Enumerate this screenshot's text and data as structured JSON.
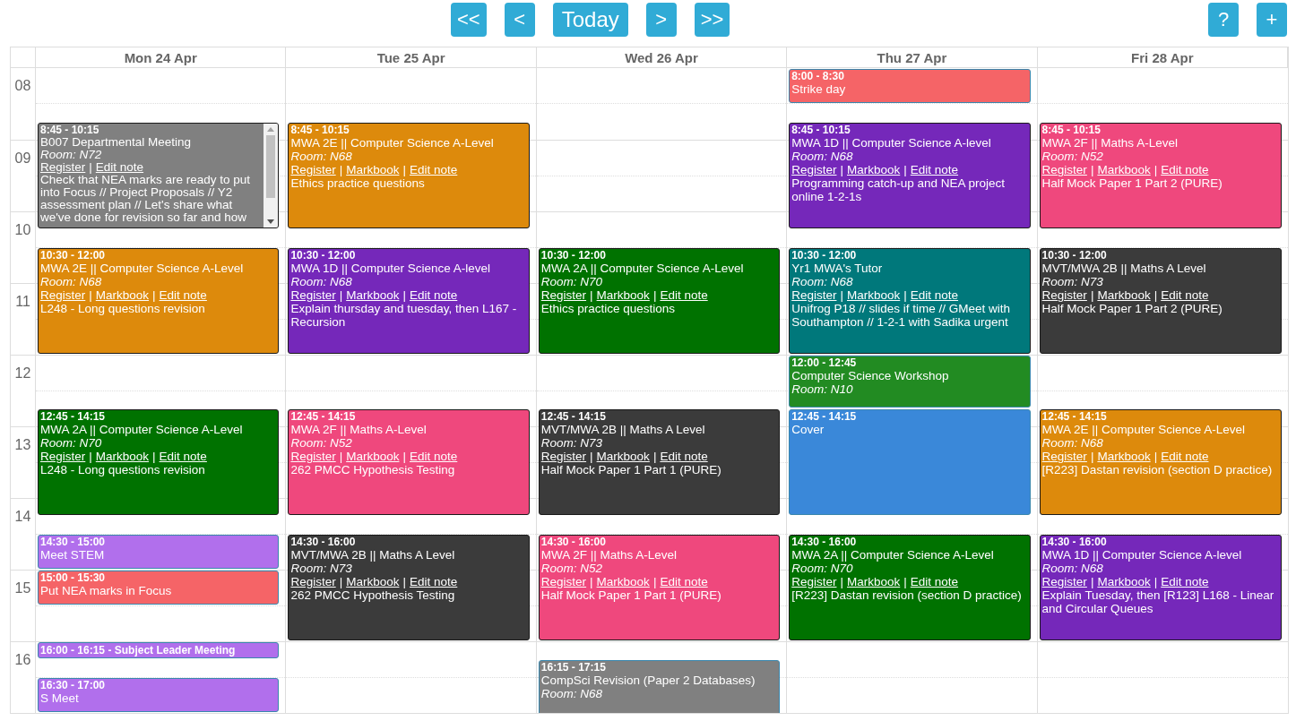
{
  "toolbar": {
    "nav_buttons": [
      "<<",
      "<",
      "Today",
      ">",
      ">>"
    ],
    "action_buttons": [
      "?",
      "+"
    ]
  },
  "link_separator": "|",
  "hours": [
    "08",
    "09",
    "10",
    "11",
    "12",
    "13",
    "14",
    "15",
    "16"
  ],
  "days": [
    {
      "header": "Mon 24 Apr",
      "events": [
        {
          "kind": "lesson",
          "color": "#808080",
          "time": "8:45 - 10:15",
          "title": "B007 Departmental Meeting",
          "room": "Room: N72",
          "links": [
            "Register",
            "Edit note"
          ],
          "note": "Check that NEA marks are ready to put into Focus // Project Proposals // Y2 assessment plan // Let's share what we've done for revision so far and how",
          "scrollable": true
        },
        {
          "kind": "lesson",
          "color": "#dd8a0c",
          "time": "10:30 - 12:00",
          "title": "MWA 2E || Computer Science A-Level",
          "room": "Room: N68",
          "links": [
            "Register",
            "Markbook",
            "Edit note"
          ],
          "note": "L248 - Long questions revision"
        },
        {
          "kind": "lesson",
          "color": "#007200",
          "time": "12:45 - 14:15",
          "title": "MWA 2A || Computer Science A-Level",
          "room": "Room: N70",
          "links": [
            "Register",
            "Markbook",
            "Edit note"
          ],
          "note": "L248 - Long questions revision"
        },
        {
          "kind": "meeting",
          "color": "#b16fec",
          "time": "14:30 - 15:00",
          "title": "Meet STEM"
        },
        {
          "kind": "meeting",
          "color": "#f56467",
          "time": "15:00 - 15:30",
          "title": "Put NEA marks in Focus"
        },
        {
          "kind": "compact",
          "color": "#b16fec",
          "label": "16:00 - 16:15 - Subject Leader Meeting"
        },
        {
          "kind": "meeting",
          "color": "#b16fec",
          "time": "16:30 - 17:00",
          "title": "S Meet"
        }
      ]
    },
    {
      "header": "Tue 25 Apr",
      "events": [
        {
          "kind": "lesson",
          "color": "#dd8a0c",
          "time": "8:45 - 10:15",
          "title": "MWA 2E || Computer Science A-Level",
          "room": "Room: N68",
          "links": [
            "Register",
            "Markbook",
            "Edit note"
          ],
          "note": "Ethics practice questions"
        },
        {
          "kind": "lesson",
          "color": "#7528ba",
          "time": "10:30 - 12:00",
          "title": "MWA 1D || Computer Science A-level",
          "room": "Room: N68",
          "links": [
            "Register",
            "Markbook",
            "Edit note"
          ],
          "note": "Explain thursday and tuesday, then L167 - Recursion"
        },
        {
          "kind": "lesson",
          "color": "#ef487d",
          "time": "12:45 - 14:15",
          "title": "MWA 2F || Maths A-Level",
          "room": "Room: N52",
          "links": [
            "Register",
            "Markbook",
            "Edit note"
          ],
          "note": "262 PMCC Hypothesis Testing"
        },
        {
          "kind": "lesson",
          "color": "#3b3b3b",
          "time": "14:30 - 16:00",
          "title": "MVT/MWA 2B || Maths A Level",
          "room": "Room: N73",
          "links": [
            "Register",
            "Markbook",
            "Edit note"
          ],
          "note": "262 PMCC Hypothesis Testing"
        }
      ]
    },
    {
      "header": "Wed 26 Apr",
      "events": [
        {
          "kind": "lesson",
          "color": "#007200",
          "time": "10:30 - 12:00",
          "title": "MWA 2A || Computer Science A-Level",
          "room": "Room: N70",
          "links": [
            "Register",
            "Markbook",
            "Edit note"
          ],
          "note": "Ethics practice questions"
        },
        {
          "kind": "lesson",
          "color": "#3b3b3b",
          "time": "12:45 - 14:15",
          "title": "MVT/MWA 2B || Maths A Level",
          "room": "Room: N73",
          "links": [
            "Register",
            "Markbook",
            "Edit note"
          ],
          "note": "Half Mock Paper 1 Part 1 (PURE)"
        },
        {
          "kind": "lesson",
          "color": "#ef487d",
          "time": "14:30 - 16:00",
          "title": "MWA 2F || Maths A-Level",
          "room": "Room: N52",
          "links": [
            "Register",
            "Markbook",
            "Edit note"
          ],
          "note": "Half Mock Paper 1 Part 1 (PURE)"
        },
        {
          "kind": "meeting",
          "color": "#808080",
          "time": "16:15 - 17:15",
          "title": "CompSci Revision (Paper 2 Databases)",
          "room": "Room: N68"
        }
      ]
    },
    {
      "header": "Thu 27 Apr",
      "events": [
        {
          "kind": "meeting",
          "color": "#f56467",
          "time": "8:00 - 8:30",
          "title": "Strike day"
        },
        {
          "kind": "lesson",
          "color": "#7528ba",
          "time": "8:45 - 10:15",
          "title": "MWA 1D || Computer Science A-level",
          "room": "Room: N68",
          "links": [
            "Register",
            "Markbook",
            "Edit note"
          ],
          "note": "Programming catch-up and NEA project online 1-2-1s"
        },
        {
          "kind": "lesson",
          "color": "#00787b",
          "time": "10:30 - 12:00",
          "title": "Yr1 MWA's Tutor",
          "room": "Room: N68",
          "links": [
            "Register",
            "Markbook",
            "Edit note"
          ],
          "note": "Unifrog P18 // slides if time // GMeet with Southampton // 1-2-1 with Sadika urgent"
        },
        {
          "kind": "meeting",
          "color": "#228b22",
          "time": "12:00 - 12:45",
          "title": "Computer Science Workshop",
          "room": "Room: N10"
        },
        {
          "kind": "meeting",
          "color": "#3a88d9",
          "time": "12:45 - 14:15",
          "title": "Cover"
        },
        {
          "kind": "lesson",
          "color": "#007200",
          "time": "14:30 - 16:00",
          "title": "MWA 2A || Computer Science A-Level",
          "room": "Room: N70",
          "links": [
            "Register",
            "Markbook",
            "Edit note"
          ],
          "note": "[R223] Dastan revision (section D practice)"
        }
      ]
    },
    {
      "header": "Fri 28 Apr",
      "events": [
        {
          "kind": "lesson",
          "color": "#ef487d",
          "time": "8:45 - 10:15",
          "title": "MWA 2F || Maths A-Level",
          "room": "Room: N52",
          "links": [
            "Register",
            "Markbook",
            "Edit note"
          ],
          "note": "Half Mock Paper 1 Part 2 (PURE)"
        },
        {
          "kind": "lesson",
          "color": "#3b3b3b",
          "time": "10:30 - 12:00",
          "title": "MVT/MWA 2B || Maths A Level",
          "room": "Room: N73",
          "links": [
            "Register",
            "Markbook",
            "Edit note"
          ],
          "note": "Half Mock Paper 1 Part 2 (PURE)"
        },
        {
          "kind": "lesson",
          "color": "#dd8a0c",
          "time": "12:45 - 14:15",
          "title": "MWA 2E || Computer Science A-Level",
          "room": "Room: N68",
          "links": [
            "Register",
            "Markbook",
            "Edit note"
          ],
          "note": "[R223] Dastan revision (section D practice)"
        },
        {
          "kind": "lesson",
          "color": "#7528ba",
          "time": "14:30 - 16:00",
          "title": "MWA 1D || Computer Science A-level",
          "room": "Room: N68",
          "links": [
            "Register",
            "Markbook",
            "Edit note"
          ],
          "note": "Explain Tuesday, then [R123] L168 - Linear and Circular Queues"
        }
      ]
    }
  ]
}
